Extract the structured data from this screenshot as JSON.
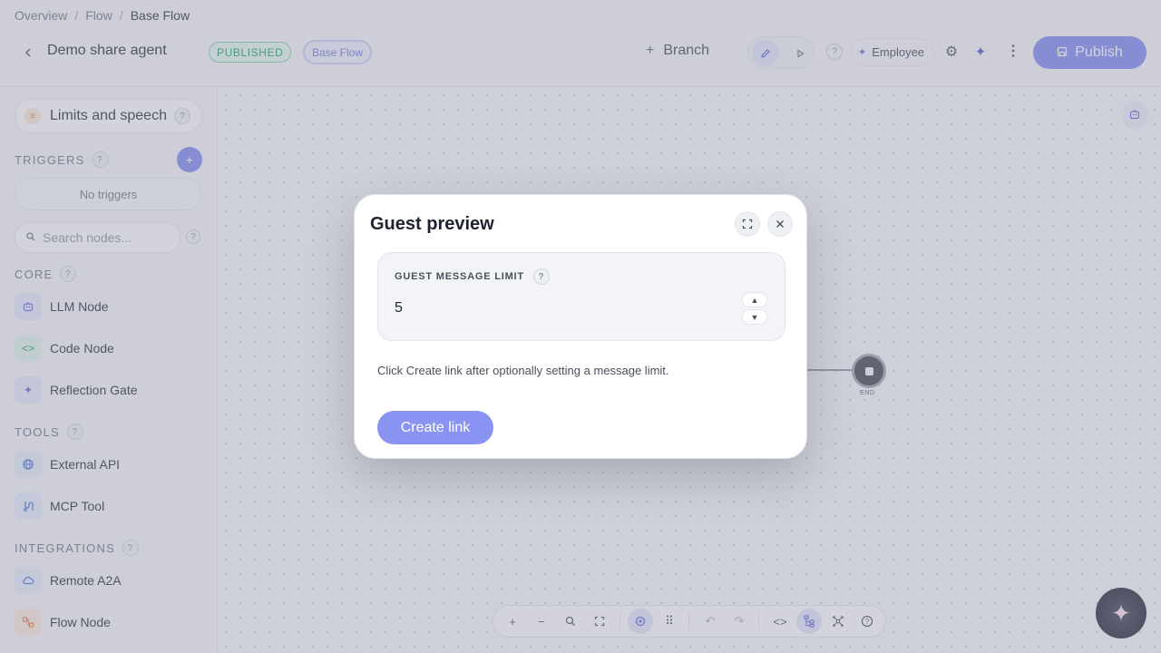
{
  "breadcrumb": {
    "items": [
      "Overview",
      "Flow"
    ],
    "separator": "/",
    "current": "Base Flow"
  },
  "header": {
    "agent_name": "Demo share agent",
    "status_badge": "PUBLISHED",
    "flow_badge": "Base Flow",
    "branch_label": "Branch",
    "role_label": "Employee",
    "publish_label": "Publish",
    "help_glyph": "?"
  },
  "sidebar": {
    "limits_label": "Limits and speech",
    "triggers_label": "TRIGGERS",
    "no_triggers": "No triggers",
    "search_placeholder": "Search nodes...",
    "sections": {
      "core": {
        "label": "CORE",
        "items": [
          "LLM Node",
          "Code Node",
          "Reflection Gate"
        ]
      },
      "tools": {
        "label": "TOOLS",
        "items": [
          "External API",
          "MCP Tool"
        ]
      },
      "integrations": {
        "label": "INTEGRATIONS",
        "items": [
          "Remote A2A",
          "Flow Node"
        ]
      }
    }
  },
  "canvas": {
    "end_label": "END"
  },
  "modal": {
    "title": "Guest preview",
    "limit_label": "GUEST MESSAGE LIMIT",
    "limit_value": "5",
    "hint": "Click Create link after optionally setting a message limit.",
    "create_button": "Create link"
  },
  "colors": {
    "accent": "#7c86f0",
    "published_green": "#1c9a63",
    "flow_badge": "#6b74d8",
    "overlay": "rgba(150,152,170,0.42)"
  },
  "icons": {
    "back": "chevron-left-icon",
    "edit": "pencil-icon",
    "play": "play-icon",
    "settings": "gear-icon",
    "magic": "sparkle-icon",
    "more": "kebab-icon",
    "save": "save-icon",
    "robot": "robot-icon",
    "expand": "expand-icon",
    "close": "close-icon"
  }
}
